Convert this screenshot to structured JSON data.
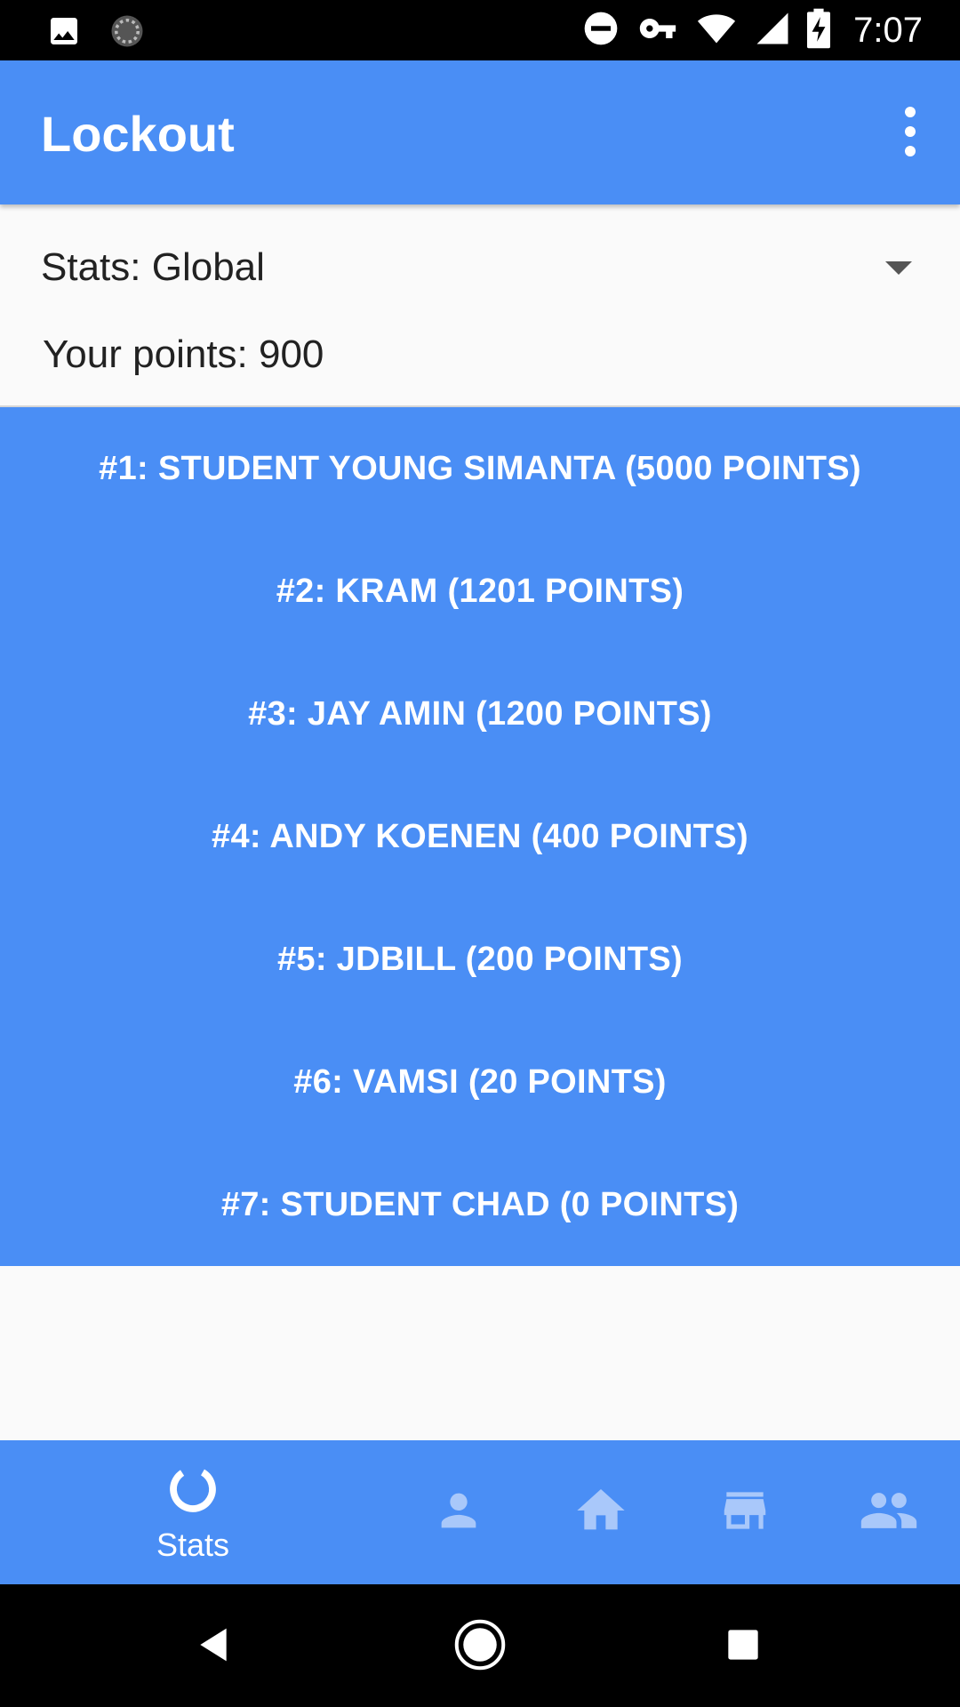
{
  "status_bar": {
    "time": "7:07",
    "icons": [
      "image-icon",
      "sync-icon",
      "do-not-disturb-icon",
      "vpn-key-icon",
      "wifi-icon",
      "signal-icon",
      "battery-charging-icon"
    ]
  },
  "app_bar": {
    "title": "Lockout",
    "menu_icon": "more-vert-icon"
  },
  "filter": {
    "stats_selected": "Stats: Global",
    "your_points": "Your points: 900"
  },
  "leaderboard": [
    "#1: STUDENT YOUNG SIMANTA (5000 POINTS)",
    "#2: KRAM (1201 POINTS)",
    "#3: JAY AMIN (1200 POINTS)",
    "#4: ANDY KOENEN (400 POINTS)",
    "#5: JDBILL (200 POINTS)",
    "#6: VAMSI (20 POINTS)",
    "#7: STUDENT CHAD (0 POINTS)"
  ],
  "bottom_nav": {
    "items": [
      {
        "icon": "stats-ring-icon",
        "label": "Stats",
        "active": true
      },
      {
        "icon": "person-icon",
        "label": "",
        "active": false
      },
      {
        "icon": "home-icon",
        "label": "",
        "active": false
      },
      {
        "icon": "store-icon",
        "label": "",
        "active": false
      },
      {
        "icon": "group-icon",
        "label": "",
        "active": false
      }
    ]
  },
  "system_nav": [
    "back-icon",
    "home-circle-icon",
    "recents-icon"
  ],
  "colors": {
    "primary": "#4a8ef5",
    "inactive_icon": "#a9c8fa",
    "background": "#fafafa"
  }
}
